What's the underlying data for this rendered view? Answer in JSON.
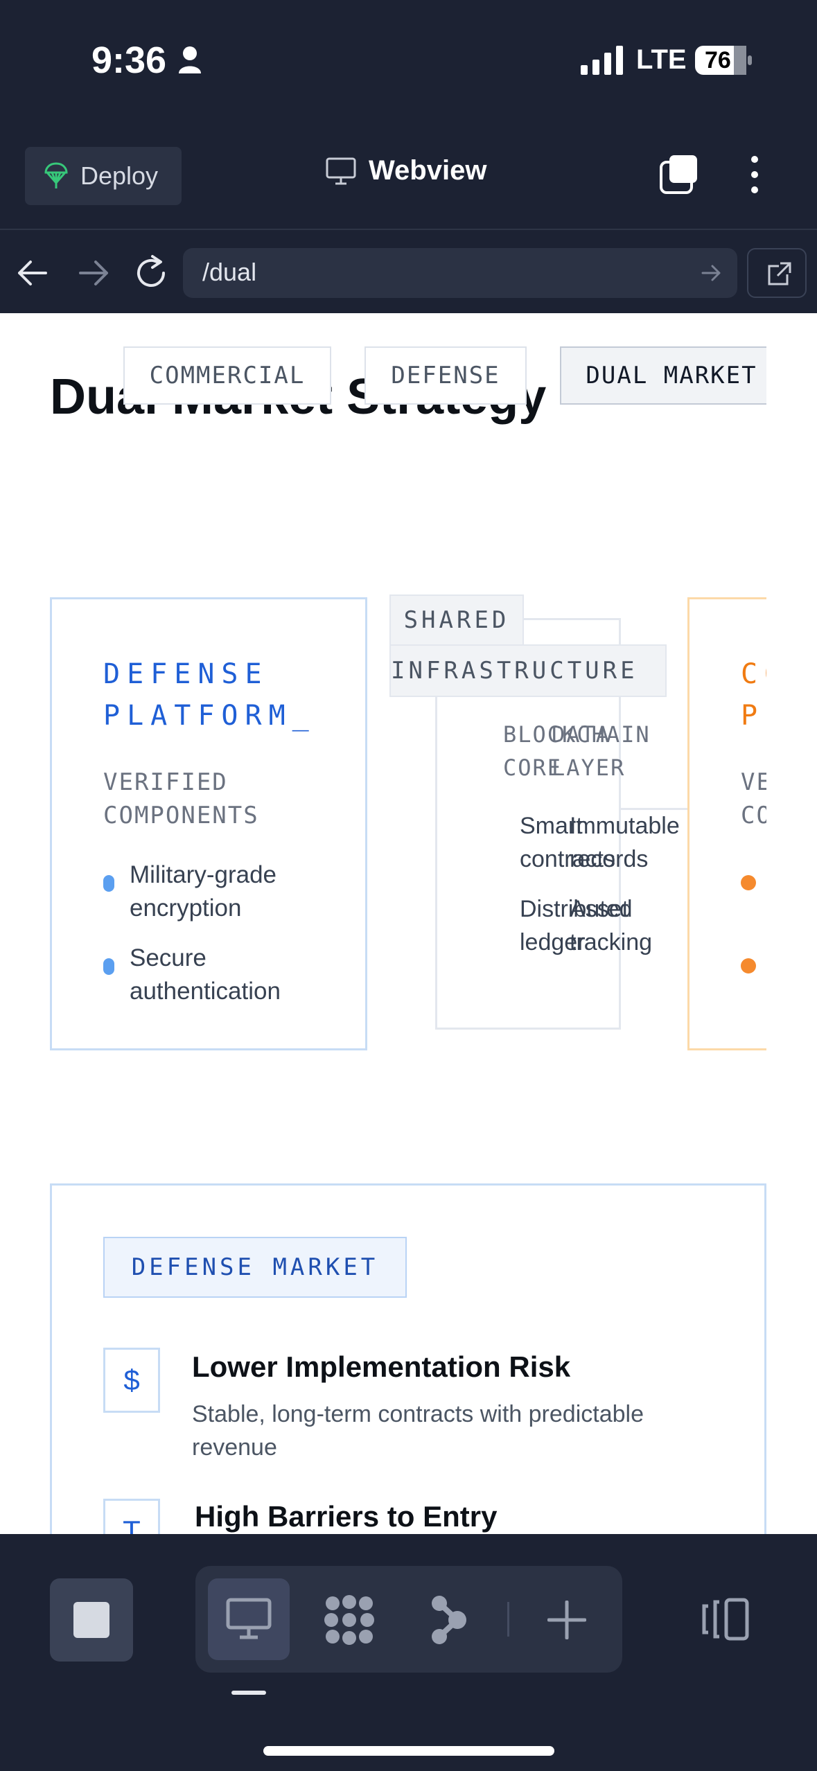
{
  "status_bar": {
    "time": "9:36",
    "network": "LTE",
    "battery": "76"
  },
  "toolbar": {
    "deploy_label": "Deploy",
    "title": "Webview"
  },
  "address_bar": {
    "url": "/dual"
  },
  "page": {
    "title": "Dual Market Strategy",
    "tabs": [
      {
        "label": "COMMERCIAL",
        "active": false
      },
      {
        "label": "DEFENSE",
        "active": false
      },
      {
        "label": "DUAL MARKET",
        "active": true
      }
    ],
    "defense_platform": {
      "title_line1": "DEFENSE",
      "title_line2": "PLATFORM_",
      "sub_line1": "VERIFIED",
      "sub_line2": "COMPONENTS",
      "items": [
        {
          "line1": "Military-grade",
          "line2": "encryption"
        },
        {
          "line1": "Secure",
          "line2": "authentication"
        }
      ],
      "accent": "#1f5fd6"
    },
    "shared": {
      "label_line1": "SHARED",
      "label_line2": "INFRASTRUCTURE",
      "blockchain_core": {
        "line1": "BLOCKCHAIN",
        "line2": "CORE"
      },
      "data_layer": {
        "line1": "DATA",
        "line2": "LAYER"
      },
      "core_items": [
        {
          "line1": "Smart",
          "line2": "contracts"
        },
        {
          "line1": "Distributed",
          "line2": "ledger"
        }
      ],
      "data_items": [
        {
          "line1": "Immutable",
          "line2": "records"
        },
        {
          "line1": "Asset",
          "line2": "tracking"
        }
      ]
    },
    "commercial_platform": {
      "title_line1": "CO",
      "title_line2": "P",
      "sub_line1": "VE",
      "sub_line2": "CO",
      "accent": "#f5821f"
    },
    "defense_market": {
      "badge": "DEFENSE MARKET",
      "features": [
        {
          "icon": "$",
          "title": "Lower Implementation Risk",
          "desc": "Stable, long-term contracts with predictable revenue"
        },
        {
          "icon": "T",
          "title": "High Barriers to Entry",
          "desc": ""
        }
      ]
    }
  }
}
